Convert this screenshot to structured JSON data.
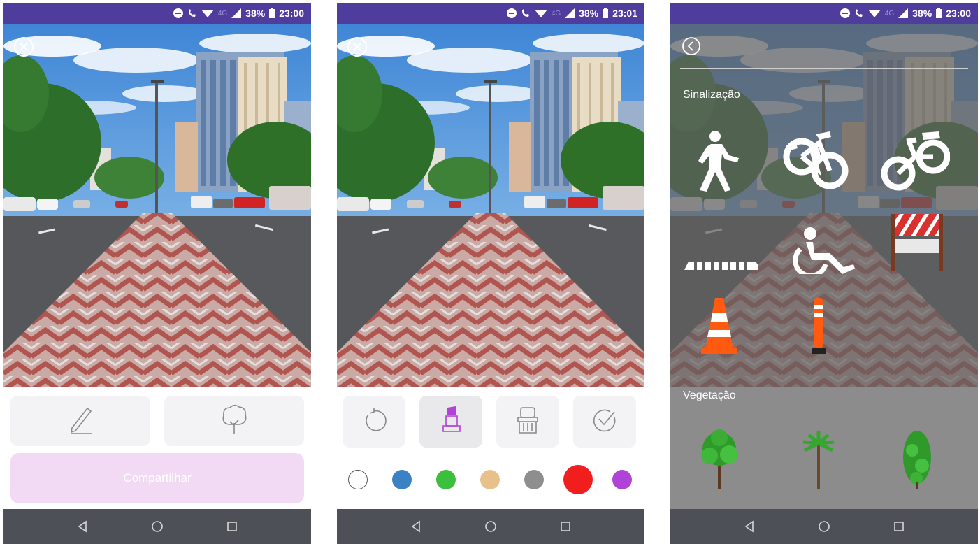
{
  "status_bar": {
    "battery": "38%",
    "network": "4G",
    "screens": [
      {
        "time": "23:00"
      },
      {
        "time": "23:01"
      },
      {
        "time": "23:00"
      }
    ]
  },
  "screen1": {
    "share_label": "Compartilhar"
  },
  "screen2": {
    "colors": [
      "#ffffff",
      "#3b82c4",
      "#3cbf3c",
      "#e8c08a",
      "#8e8e8e",
      "#f11e1e",
      "#b042d8"
    ],
    "selected_color": "#f11e1e",
    "selected_tool": "marker"
  },
  "screen3": {
    "section_signage": "Sinalização",
    "section_vegetation": "Vegetação",
    "signage_items": [
      "pedestrian-icon",
      "bicycle-marking-icon",
      "bicycle-icon",
      "crosswalk-icon",
      "wheelchair-icon",
      "barrier-icon",
      "traffic-cone-icon",
      "delineator-post-icon"
    ],
    "vegetation_items": [
      "tree-icon",
      "palm-tree-icon",
      "cypress-tree-icon"
    ]
  },
  "colors": {
    "status_bar": "#4e3d9c",
    "nav_bar": "#4d5056",
    "share_button": "#f2d9f4",
    "tool_button": "#f3f2f4",
    "accent_purple": "#b042d8"
  }
}
